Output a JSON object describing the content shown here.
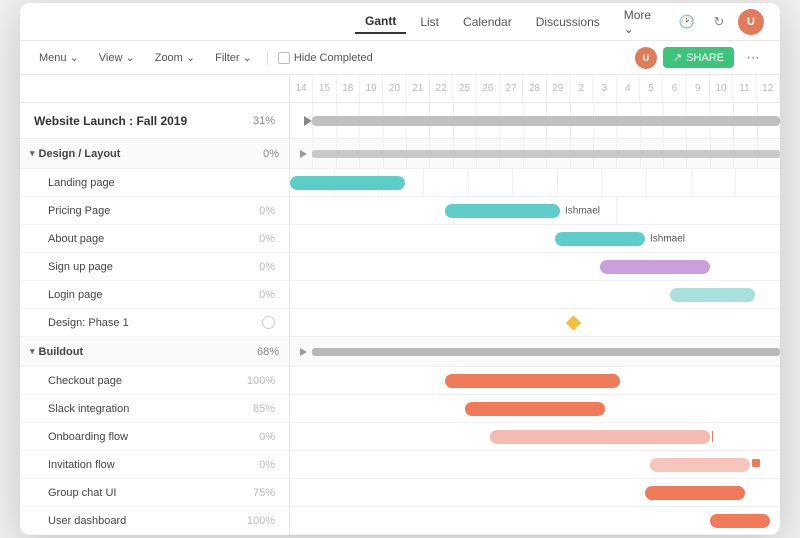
{
  "window": {
    "title": "Website Launch : Fall 2019"
  },
  "topNav": {
    "tabs": [
      {
        "label": "Gantt",
        "active": true
      },
      {
        "label": "List",
        "active": false
      },
      {
        "label": "Calendar",
        "active": false
      },
      {
        "label": "Discussions",
        "active": false
      },
      {
        "label": "More",
        "active": false,
        "hasChevron": true
      }
    ],
    "icons": {
      "history": "🕐",
      "refresh": "↻",
      "settings": "⚙"
    }
  },
  "toolbar": {
    "menu": "Menu",
    "view": "View",
    "zoom": "Zoom",
    "filter": "Filter",
    "hideCompleted": "Hide Completed",
    "share": "SHARE"
  },
  "dates": [
    "14",
    "15",
    "18",
    "19",
    "20",
    "21",
    "22",
    "25",
    "26",
    "27",
    "28",
    "29",
    "2",
    "3",
    "4",
    "5",
    "6",
    "9",
    "10",
    "11",
    "12"
  ],
  "project": {
    "name": "Website Launch : Fall 2019",
    "pct": "31%"
  },
  "sections": [
    {
      "name": "Design / Layout",
      "pct": "0%",
      "tasks": [
        {
          "name": "Landing page",
          "pct": ""
        },
        {
          "name": "Pricing Page",
          "pct": "0%"
        },
        {
          "name": "About page",
          "pct": "0%"
        },
        {
          "name": "Sign up page",
          "pct": "0%"
        },
        {
          "name": "Login page",
          "pct": "0%"
        },
        {
          "name": "Design: Phase 1",
          "pct": "",
          "hasCheckbox": true
        }
      ]
    },
    {
      "name": "Buildout",
      "pct": "68%",
      "tasks": [
        {
          "name": "Checkout page",
          "pct": "100%"
        },
        {
          "name": "Slack integration",
          "pct": "85%"
        },
        {
          "name": "Onboarding flow",
          "pct": "0%"
        },
        {
          "name": "Invitation flow",
          "pct": "0%"
        },
        {
          "name": "Group chat UI",
          "pct": "75%"
        },
        {
          "name": "User dashboard",
          "pct": "100%"
        }
      ]
    }
  ]
}
